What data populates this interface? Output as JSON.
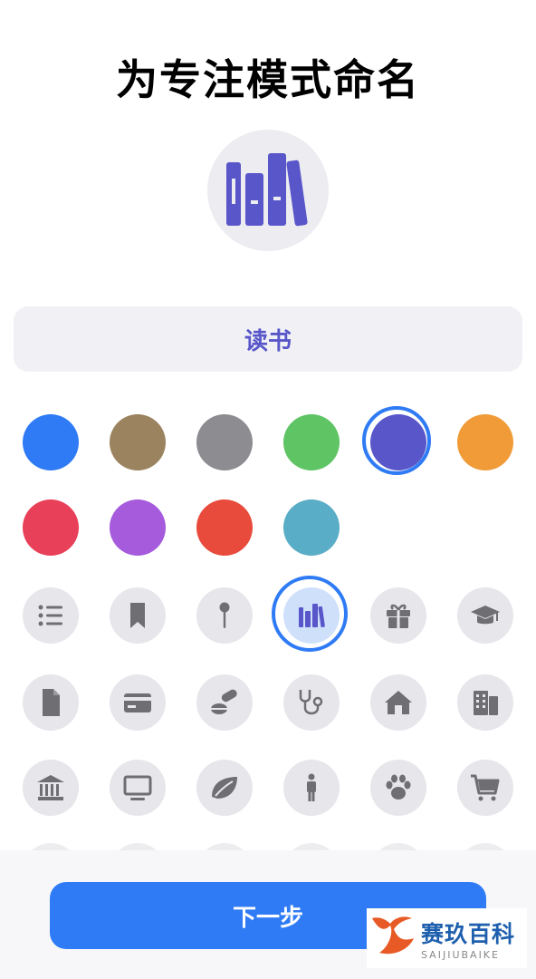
{
  "title": "为专注模式命名",
  "preview": {
    "icon": "books-icon",
    "color": "#5856C9"
  },
  "name_field": {
    "value": "读书"
  },
  "colors": {
    "accent": "#2F7BF5",
    "selected": "#5856C9",
    "swatches": [
      "#2F7BF5",
      "#9C8360",
      "#8C8C91",
      "#5EC464",
      "#5856C9",
      "#F09B38",
      "#E84059",
      "#A55BDC",
      "#E84A3B",
      "#59ADC6"
    ]
  },
  "icons": [
    "list-icon",
    "bookmark-icon",
    "pin-icon",
    "books-icon",
    "gift-icon",
    "graduation-cap-icon",
    "document-icon",
    "credit-card-icon",
    "pills-icon",
    "stethoscope-icon",
    "house-icon",
    "building-icon",
    "bank-icon",
    "monitor-icon",
    "leaf-icon",
    "person-icon",
    "paw-icon",
    "cart-icon"
  ],
  "next_button": {
    "label": "下一步"
  },
  "watermark": {
    "main": "赛玖百科",
    "sub": "SAIJIUBAIKE"
  }
}
